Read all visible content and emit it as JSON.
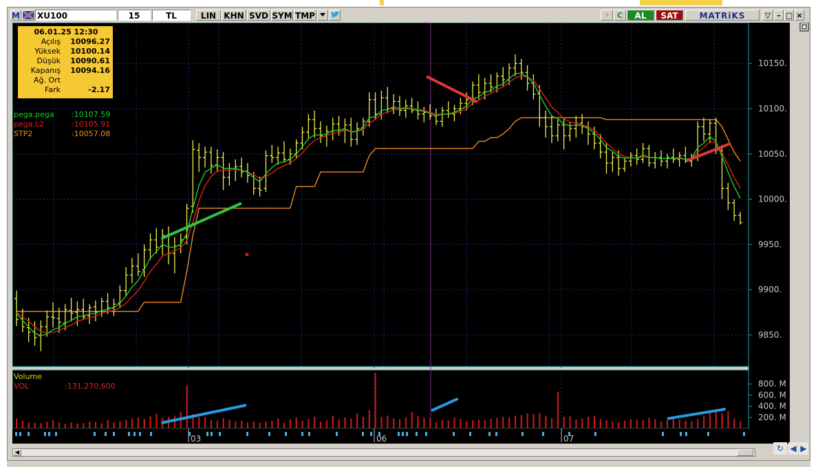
{
  "toolbar": {
    "m_label": "M",
    "symbol": "XU100",
    "period": "15",
    "currency": "TL",
    "buttons": [
      "LIN",
      "KHN",
      "SVD",
      "SYM",
      "TMP"
    ],
    "al": "AL",
    "sat": "SAT",
    "brand": "MATRiKS"
  },
  "infobox": {
    "datetime": "06.01.25 12:30",
    "rows": [
      {
        "label": "Açılış",
        "value": "10096.27"
      },
      {
        "label": "Yüksek",
        "value": "10100.14"
      },
      {
        "label": "Düşük",
        "value": "10090.61"
      },
      {
        "label": "Kapanış",
        "value": "10094.16"
      },
      {
        "label": "Ağ. Ort",
        "value": ""
      },
      {
        "label": "Fark",
        "value": "-2.17"
      }
    ]
  },
  "indicators": [
    {
      "name": "pega.pega",
      "value": ":10107.59",
      "color": "#22cc22"
    },
    {
      "name": "pega.L2",
      "value": ":10105.91",
      "color": "#e02020"
    },
    {
      "name": "STP2",
      "value": ":10057.08",
      "color": "#ee8a22"
    }
  ],
  "volume_legend": {
    "title": "Volume",
    "name": "VOL",
    "value": ":131,270,600"
  },
  "chart_data": {
    "type": "bar",
    "price_axis": {
      "ticks": [
        "10150.",
        "10100.",
        "10050.",
        "10000.",
        "9950.",
        "9900.",
        "9850."
      ],
      "ylim": [
        9815,
        10195
      ]
    },
    "volume_axis": {
      "ticks": [
        "800. M",
        "600. M",
        "400. M",
        "200. M"
      ],
      "ylim": [
        0,
        1000
      ]
    },
    "date_labels": [
      "03",
      "06",
      "07"
    ],
    "ohlc": [
      [
        9890,
        9899,
        9860,
        9867
      ],
      [
        9868,
        9879,
        9853,
        9859
      ],
      [
        9858,
        9869,
        9842,
        9853
      ],
      [
        9853,
        9865,
        9838,
        9847
      ],
      [
        9849,
        9866,
        9832,
        9859
      ],
      [
        9859,
        9877,
        9848,
        9870
      ],
      [
        9870,
        9886,
        9858,
        9869
      ],
      [
        9868,
        9880,
        9852,
        9864
      ],
      [
        9863,
        9884,
        9855,
        9878
      ],
      [
        9877,
        9891,
        9865,
        9874
      ],
      [
        9875,
        9887,
        9860,
        9878
      ],
      [
        9878,
        9890,
        9867,
        9870
      ],
      [
        9871,
        9884,
        9862,
        9880
      ],
      [
        9881,
        9888,
        9865,
        9875
      ],
      [
        9876,
        9891,
        9870,
        9887
      ],
      [
        9887,
        9896,
        9873,
        9880
      ],
      [
        9880,
        9890,
        9871,
        9884
      ],
      [
        9885,
        9905,
        9880,
        9899
      ],
      [
        9899,
        9925,
        9893,
        9916
      ],
      [
        9916,
        9935,
        9907,
        9926
      ],
      [
        9926,
        9940,
        9915,
        9920
      ],
      [
        9922,
        9950,
        9914,
        9944
      ],
      [
        9944,
        9962,
        9933,
        9955
      ],
      [
        9955,
        9968,
        9940,
        9947
      ],
      [
        9948,
        9967,
        9938,
        9960
      ],
      [
        9960,
        9970,
        9928,
        9940
      ],
      [
        9940,
        9958,
        9918,
        9948
      ],
      [
        9949,
        9962,
        9940,
        9955
      ],
      [
        9958,
        9995,
        9950,
        9990
      ],
      [
        9992,
        10065,
        9985,
        10055
      ],
      [
        10054,
        10062,
        10030,
        10046
      ],
      [
        10046,
        10058,
        10035,
        10052
      ],
      [
        10052,
        10058,
        10028,
        10037
      ],
      [
        10038,
        10055,
        10030,
        10046
      ],
      [
        10046,
        10052,
        10010,
        10024
      ],
      [
        10024,
        10040,
        10015,
        10034
      ],
      [
        10034,
        10044,
        10020,
        10036
      ],
      [
        10036,
        10046,
        10024,
        10030
      ],
      [
        10031,
        10040,
        10018,
        10026
      ],
      [
        10025,
        10030,
        10005,
        10012
      ],
      [
        10012,
        10025,
        10003,
        10010
      ],
      [
        10012,
        10054,
        10008,
        10048
      ],
      [
        10048,
        10060,
        10040,
        10046
      ],
      [
        10046,
        10058,
        10038,
        10051
      ],
      [
        10051,
        10064,
        10041,
        10044
      ],
      [
        10044,
        10056,
        10038,
        10050
      ],
      [
        10050,
        10066,
        10045,
        10062
      ],
      [
        10062,
        10080,
        10055,
        10074
      ],
      [
        10074,
        10094,
        10066,
        10088
      ],
      [
        10088,
        10098,
        10068,
        10078
      ],
      [
        10078,
        10086,
        10062,
        10070
      ],
      [
        10070,
        10081,
        10058,
        10075
      ],
      [
        10075,
        10090,
        10065,
        10083
      ],
      [
        10083,
        10092,
        10070,
        10076
      ],
      [
        10076,
        10089,
        10062,
        10082
      ],
      [
        10082,
        10090,
        10058,
        10066
      ],
      [
        10066,
        10085,
        10060,
        10078
      ],
      [
        10079,
        10090,
        10070,
        10086
      ],
      [
        10086,
        10118,
        10080,
        10110
      ],
      [
        10110,
        10118,
        10088,
        10094
      ],
      [
        10094,
        10120,
        10088,
        10112
      ],
      [
        10112,
        10124,
        10095,
        10100
      ],
      [
        10100,
        10116,
        10094,
        10108
      ],
      [
        10108,
        10114,
        10092,
        10098
      ],
      [
        10098,
        10110,
        10090,
        10103
      ],
      [
        10103,
        10112,
        10095,
        10098
      ],
      [
        10098,
        10108,
        10088,
        10094
      ],
      [
        10094,
        10102,
        10085,
        10096
      ],
      [
        10096,
        10105,
        10088,
        10092
      ],
      [
        10092,
        10100,
        10082,
        10086
      ],
      [
        10086,
        10102,
        10080,
        10098
      ],
      [
        10098,
        10108,
        10090,
        10094
      ],
      [
        10094,
        10104,
        10086,
        10100
      ],
      [
        10100,
        10112,
        10094,
        10106
      ],
      [
        10106,
        10118,
        10098,
        10110
      ],
      [
        10110,
        10130,
        10104,
        10126
      ],
      [
        10126,
        10138,
        10110,
        10118
      ],
      [
        10118,
        10134,
        10110,
        10128
      ],
      [
        10128,
        10138,
        10118,
        10124
      ],
      [
        10124,
        10140,
        10118,
        10136
      ],
      [
        10136,
        10146,
        10125,
        10132
      ],
      [
        10132,
        10150,
        10126,
        10145
      ],
      [
        10145,
        10160,
        10136,
        10150
      ],
      [
        10150,
        10155,
        10132,
        10140
      ],
      [
        10140,
        10148,
        10120,
        10128
      ],
      [
        10128,
        10138,
        10110,
        10116
      ],
      [
        10116,
        10126,
        10080,
        10090
      ],
      [
        10090,
        10098,
        10068,
        10080
      ],
      [
        10080,
        10092,
        10062,
        10070
      ],
      [
        10070,
        10088,
        10064,
        10082
      ],
      [
        10082,
        10090,
        10055,
        10070
      ],
      [
        10070,
        10085,
        10064,
        10078
      ],
      [
        10078,
        10092,
        10068,
        10084
      ],
      [
        10084,
        10094,
        10072,
        10080
      ],
      [
        10080,
        10086,
        10060,
        10072
      ],
      [
        10072,
        10080,
        10055,
        10062
      ],
      [
        10062,
        10072,
        10045,
        10052
      ],
      [
        10052,
        10062,
        10028,
        10040
      ],
      [
        10040,
        10052,
        10030,
        10046
      ],
      [
        10046,
        10054,
        10026,
        10034
      ],
      [
        10034,
        10046,
        10030,
        10042
      ],
      [
        10042,
        10052,
        10036,
        10048
      ],
      [
        10048,
        10056,
        10038,
        10044
      ],
      [
        10044,
        10062,
        10040,
        10056
      ],
      [
        10056,
        10060,
        10036,
        10040
      ],
      [
        10040,
        10052,
        10034,
        10046
      ],
      [
        10046,
        10054,
        10036,
        10042
      ],
      [
        10042,
        10050,
        10034,
        10046
      ],
      [
        10046,
        10056,
        10040,
        10044
      ],
      [
        10044,
        10052,
        10036,
        10048
      ],
      [
        10048,
        10058,
        10040,
        10042
      ],
      [
        10042,
        10050,
        10036,
        10046
      ],
      [
        10046,
        10086,
        10042,
        10080
      ],
      [
        10080,
        10090,
        10064,
        10072
      ],
      [
        10072,
        10088,
        10062,
        10084
      ],
      [
        10084,
        10090,
        10050,
        10054
      ],
      [
        10054,
        10060,
        10000,
        10012
      ],
      [
        10012,
        10018,
        9988,
        9996
      ],
      [
        9996,
        10000,
        9976,
        9982
      ],
      [
        9982,
        9986,
        9972,
        9974
      ]
    ],
    "pega_pega": [
      9874,
      9866,
      9859,
      9852,
      9849,
      9851,
      9856,
      9858,
      9863,
      9866,
      9870,
      9871,
      9873,
      9874,
      9877,
      9878,
      9880,
      9885,
      9893,
      9903,
      9910,
      9922,
      9935,
      9942,
      9950,
      9947,
      9947,
      9950,
      9962,
      9990,
      10015,
      10030,
      10034,
      10038,
      10034,
      10034,
      10034,
      10032,
      10030,
      10024,
      10019,
      10028,
      10035,
      10040,
      10041,
      10044,
      10050,
      10058,
      10067,
      10071,
      10071,
      10072,
      10076,
      10076,
      10078,
      10074,
      10075,
      10079,
      10090,
      10091,
      10098,
      10099,
      10102,
      10100,
      10101,
      10100,
      10098,
      10097,
      10095,
      10092,
      10094,
      10094,
      10096,
      10099,
      10103,
      10111,
      10113,
      10118,
      10120,
      10125,
      10127,
      10133,
      10139,
      10139,
      10135,
      10128,
      10115,
      10103,
      10092,
      10089,
      10083,
      10081,
      10082,
      10081,
      10078,
      10073,
      10066,
      10057,
      10053,
      10047,
      10045,
      10046,
      10045,
      10049,
      10046,
      10046,
      10045,
      10045,
      10045,
      10046,
      10044,
      10045,
      10057,
      10062,
      10069,
      10064,
      10047,
      10030,
      10014,
      10001
    ],
    "pega_L2": [
      9875,
      9870,
      9865,
      9859,
      9854,
      9852,
      9853,
      9855,
      9858,
      9861,
      9865,
      9867,
      9869,
      9871,
      9874,
      9876,
      9877,
      9880,
      9885,
      9892,
      9899,
      9909,
      9920,
      9928,
      9937,
      9940,
      9943,
      9946,
      9954,
      9975,
      9998,
      10015,
      10025,
      10031,
      10032,
      10032,
      10033,
      10032,
      10030,
      10027,
      10023,
      10025,
      10029,
      10034,
      10037,
      10040,
      10045,
      10051,
      10059,
      10065,
      10068,
      10070,
      10073,
      10074,
      10076,
      10075,
      10075,
      10077,
      10084,
      10088,
      10094,
      10096,
      10099,
      10099,
      10100,
      10100,
      10099,
      10098,
      10096,
      10094,
      10094,
      10094,
      10095,
      10097,
      10100,
      10106,
      10109,
      10114,
      10117,
      10121,
      10124,
      10129,
      10134,
      10136,
      10135,
      10131,
      10122,
      10112,
      10102,
      10096,
      10089,
      10085,
      10084,
      10082,
      10080,
      10076,
      10070,
      10062,
      10056,
      10050,
      10047,
      10046,
      10045,
      10047,
      10046,
      10046,
      10045,
      10045,
      10045,
      10045,
      10044,
      10045,
      10052,
      10057,
      10064,
      10062,
      10051,
      10038,
      10024,
      10012
    ],
    "stp2": [
      9876,
      9876,
      9876,
      9876,
      9876,
      9876,
      9876,
      9876,
      9876,
      9876,
      9876,
      9876,
      9876,
      9876,
      9876,
      9876,
      9876,
      9876,
      9876,
      9876,
      9876,
      9886,
      9886,
      9886,
      9886,
      9886,
      9886,
      9886,
      9920,
      9960,
      9990,
      9990,
      9990,
      9990,
      9990,
      9990,
      9990,
      9990,
      9990,
      9990,
      9990,
      9990,
      9990,
      9990,
      9990,
      9990,
      10014,
      10014,
      10014,
      10014,
      10030,
      10030,
      10030,
      10030,
      10030,
      10030,
      10030,
      10030,
      10048,
      10056,
      10056,
      10056,
      10056,
      10056,
      10056,
      10056,
      10056,
      10056,
      10056,
      10056,
      10056,
      10056,
      10056,
      10056,
      10056,
      10056,
      10064,
      10064,
      10068,
      10068,
      10072,
      10078,
      10086,
      10090,
      10090,
      10090,
      10090,
      10090,
      10090,
      10090,
      10090,
      10090,
      10090,
      10090,
      10090,
      10090,
      10090,
      10088,
      10088,
      10088,
      10088,
      10088,
      10088,
      10088,
      10088,
      10088,
      10088,
      10088,
      10088,
      10088,
      10088,
      10088,
      10088,
      10088,
      10088,
      10088,
      10080,
      10066,
      10052,
      10042
    ],
    "volume": [
      180,
      140,
      110,
      100,
      95,
      120,
      150,
      105,
      85,
      110,
      90,
      100,
      120,
      115,
      95,
      150,
      110,
      130,
      160,
      180,
      200,
      170,
      220,
      260,
      190,
      210,
      230,
      300,
      780,
      260,
      200,
      210,
      150,
      140,
      190,
      160,
      120,
      140,
      110,
      130,
      100,
      125,
      140,
      180,
      100,
      160,
      200,
      140,
      170,
      210,
      120,
      150,
      230,
      160,
      200,
      180,
      270,
      210,
      330,
      1000,
      210,
      230,
      180,
      160,
      200,
      300,
      230,
      200,
      180,
      110,
      150,
      140,
      200,
      170,
      130,
      150,
      160,
      150,
      170,
      190,
      210,
      200,
      230,
      240,
      270,
      260,
      280,
      230,
      190,
      660,
      210,
      220,
      160,
      180,
      210,
      230,
      170,
      150,
      120,
      110,
      140,
      170,
      160,
      150,
      190,
      170,
      130,
      150,
      180,
      160,
      140,
      130,
      170,
      220,
      300,
      330,
      270,
      310,
      180,
      130
    ],
    "annotations": [
      {
        "color": "#2ec44a",
        "x0": 24.0,
        "y0": 9957,
        "x1": 36.8,
        "y1": 9995
      },
      {
        "color": "#e03838",
        "x0": 67.6,
        "y0": 10135,
        "x1": 75.6,
        "y1": 10108
      },
      {
        "color": "#e03838",
        "x0": 110.4,
        "y0": 10043,
        "x1": 117.2,
        "y1": 10061
      },
      {
        "color": "#2a9ae0",
        "x0": 24.0,
        "y0": 105,
        "x1": 37.6,
        "y1": 415
      },
      {
        "color": "#2a9ae0",
        "x0": 68.4,
        "y0": 330,
        "x1": 72.4,
        "y1": 525
      },
      {
        "color": "#2a9ae0",
        "x0": 107.2,
        "y0": 180,
        "x1": 116.4,
        "y1": 345
      }
    ]
  }
}
